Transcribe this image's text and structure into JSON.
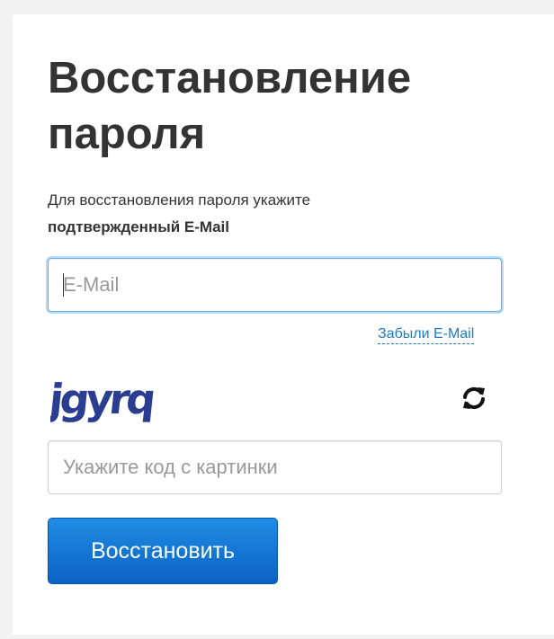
{
  "form": {
    "title": "Восстановление пароля",
    "description_line1": "Для восстановления пароля укажите",
    "description_line2": "подтвержденный E-Mail",
    "email_placeholder": "E-Mail",
    "forgot_email_link": "Забыли E-Mail",
    "captcha_text": "jgyrq",
    "captcha_placeholder": "Укажите код с картинки",
    "submit_label": "Восстановить"
  },
  "colors": {
    "link": "#1a7bc9",
    "button_top": "#1f8de3",
    "button_bottom": "#0a62c4",
    "captcha": "#2b3d91",
    "focus_border": "#66afe9"
  },
  "icons": {
    "refresh": "refresh-icon"
  }
}
